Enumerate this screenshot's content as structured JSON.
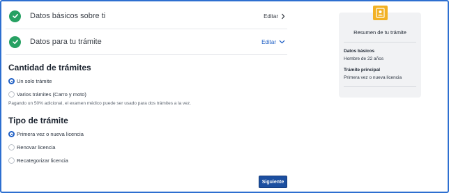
{
  "steps": [
    {
      "label": "Datos básicos sobre ti",
      "edit": "Editar"
    },
    {
      "label": "Datos para tu trámite",
      "edit": "Editar"
    }
  ],
  "cantidad": {
    "title": "Cantidad de trámites",
    "options": [
      "Un solo trámite",
      "Varios trámites (Carro y moto)"
    ],
    "selected": "Un solo trámite",
    "note": "Pagando un 50% adicional, el examen médico puede ser usado para dos trámites a la vez."
  },
  "tipo": {
    "title": "Tipo de trámite",
    "options": [
      "Primera vez o nueva licencia",
      "Renovar licencia",
      "Recategorizar licencia"
    ],
    "selected": "Primera vez o nueva licencia"
  },
  "next_button": "Siguiente",
  "summary": {
    "title": "Resumen de tu trámite",
    "datos_label": "Datos básicos",
    "datos_value": "Hombre de 22 años",
    "tramite_label": "Trámite principal",
    "tramite_value": "Primera vez o nueva licencia"
  },
  "colors": {
    "accent": "#1f5fc5",
    "success": "#27a163",
    "badge": "#f2b124"
  },
  "icons": [
    "check-icon",
    "chevron-right-icon",
    "chevron-down-icon",
    "id-badge-icon"
  ]
}
